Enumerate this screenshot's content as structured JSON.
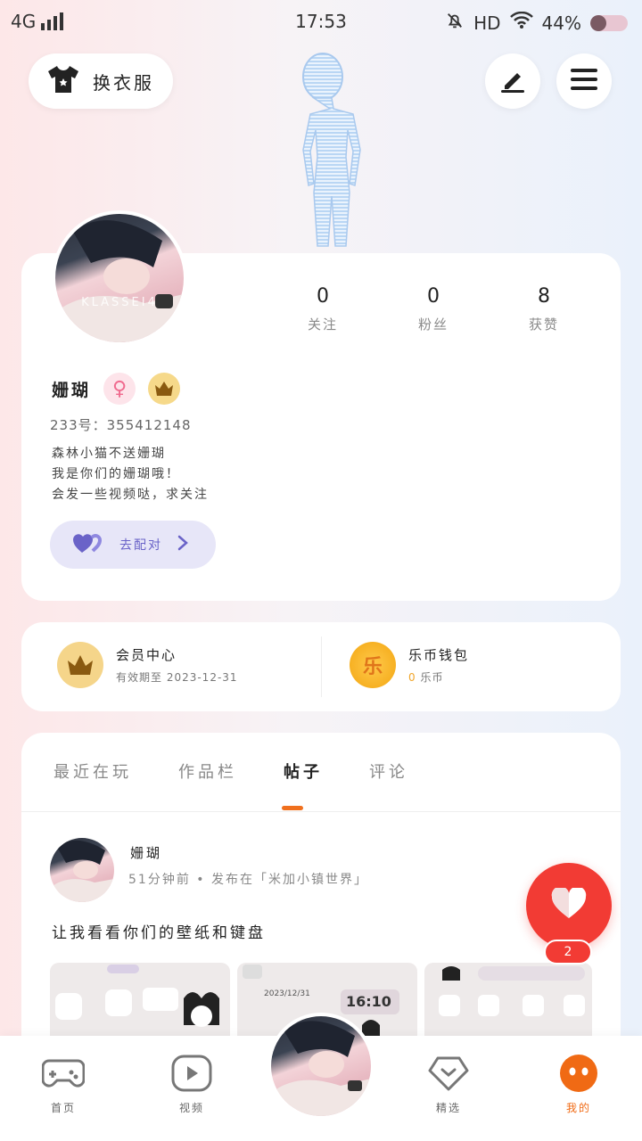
{
  "status_bar": {
    "network": "4G",
    "time": "17:53",
    "hd": "HD",
    "battery": "44%",
    "battery_level": 0.44
  },
  "header": {
    "outfit_label": "换衣服"
  },
  "profile": {
    "avatar_watermark": "KLASSEI4",
    "stats": [
      {
        "value": "0",
        "label": "关注"
      },
      {
        "value": "0",
        "label": "粉丝"
      },
      {
        "value": "8",
        "label": "获赞"
      }
    ],
    "name": "姗瑚",
    "uid": "233号：355412148",
    "bio": [
      "森林小猫不送姗瑚",
      "我是你们的姗瑚哦！",
      "会发一些视频哒，求关注"
    ],
    "pair_label": "去配对"
  },
  "vip": {
    "member_title": "会员中心",
    "member_sub": "有效期至 2023-12-31",
    "wallet_title": "乐币钱包",
    "wallet_amount": "0",
    "wallet_unit": "乐币",
    "coin_glyph": "乐"
  },
  "tabs": [
    {
      "label": "最近在玩"
    },
    {
      "label": "作品栏"
    },
    {
      "label": "帖子"
    },
    {
      "label": "评论"
    }
  ],
  "post": {
    "author": "姗瑚",
    "meta": "51分钟前 • 发布在「米加小镇世界」",
    "text": "让我看看你们的壁纸和键盘",
    "img2_date": "2023/12/31",
    "img2_time": "16:10",
    "like_count": "2"
  },
  "navbar": [
    {
      "label": "首页"
    },
    {
      "label": "视频"
    },
    {
      "label": "精选"
    },
    {
      "label": "我的"
    }
  ],
  "colors": {
    "accent": "#f06a14",
    "like": "#f23b34",
    "pair": "#6a63c8"
  }
}
